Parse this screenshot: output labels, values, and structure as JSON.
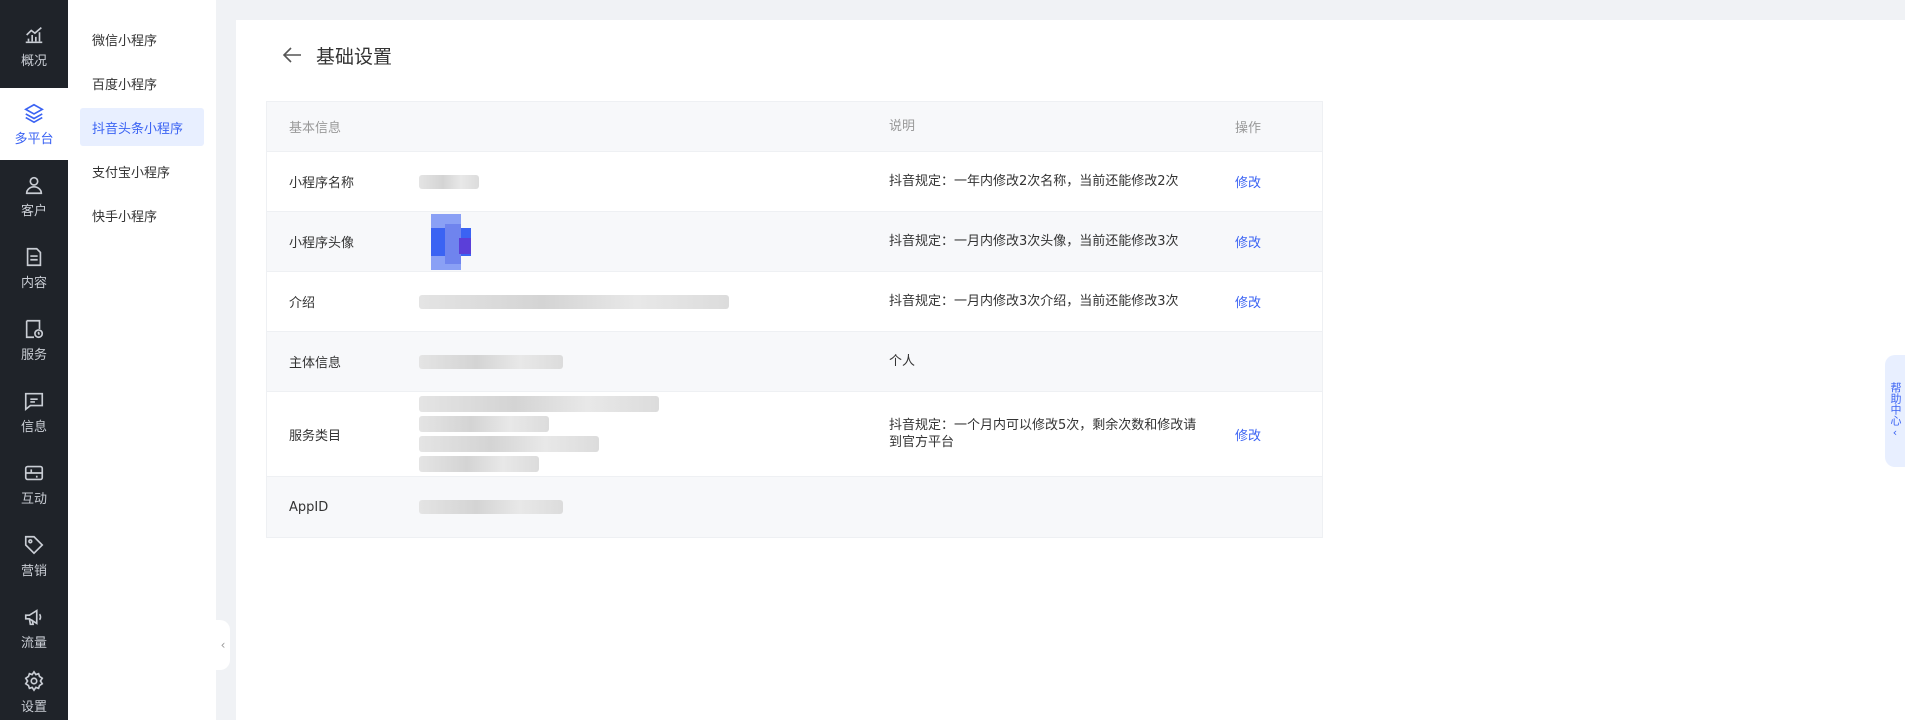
{
  "rail": {
    "items": [
      {
        "label": "概况",
        "icon": "chart-icon"
      },
      {
        "label": "多平台",
        "icon": "layers-icon"
      },
      {
        "label": "客户",
        "icon": "user-icon"
      },
      {
        "label": "内容",
        "icon": "document-icon"
      },
      {
        "label": "服务",
        "icon": "service-icon"
      },
      {
        "label": "信息",
        "icon": "message-icon"
      },
      {
        "label": "互动",
        "icon": "gamepad-icon"
      },
      {
        "label": "营销",
        "icon": "tag-icon"
      },
      {
        "label": "流量",
        "icon": "megaphone-icon"
      },
      {
        "label": "设置",
        "icon": "gear-icon"
      }
    ],
    "active_index": 1
  },
  "submenu": {
    "items": [
      "微信小程序",
      "百度小程序",
      "抖音头条小程序",
      "支付宝小程序",
      "快手小程序"
    ],
    "active_index": 2
  },
  "header": {
    "title": "基础设置"
  },
  "table": {
    "columns": {
      "info": "基本信息",
      "desc": "说明",
      "op": "操作"
    },
    "rows": [
      {
        "label": "小程序名称",
        "desc": "抖音规定：一年内修改2次名称，当前还能修改2次",
        "op": "修改"
      },
      {
        "label": "小程序头像",
        "desc": "抖音规定：一月内修改3次头像，当前还能修改3次",
        "op": "修改"
      },
      {
        "label": "介绍",
        "desc": "抖音规定：一月内修改3次介绍，当前还能修改3次",
        "op": "修改"
      },
      {
        "label": "主体信息",
        "desc": "个人",
        "op": ""
      },
      {
        "label": "服务类目",
        "desc": "抖音规定：一个月内可以修改5次，剩余次数和修改请到官方平台",
        "op": "修改"
      },
      {
        "label": "AppID",
        "desc": "",
        "op": ""
      }
    ]
  },
  "help": {
    "label": "帮助中心"
  },
  "colors": {
    "accent": "#3b63f3",
    "rail_bg": "#1f2329"
  }
}
